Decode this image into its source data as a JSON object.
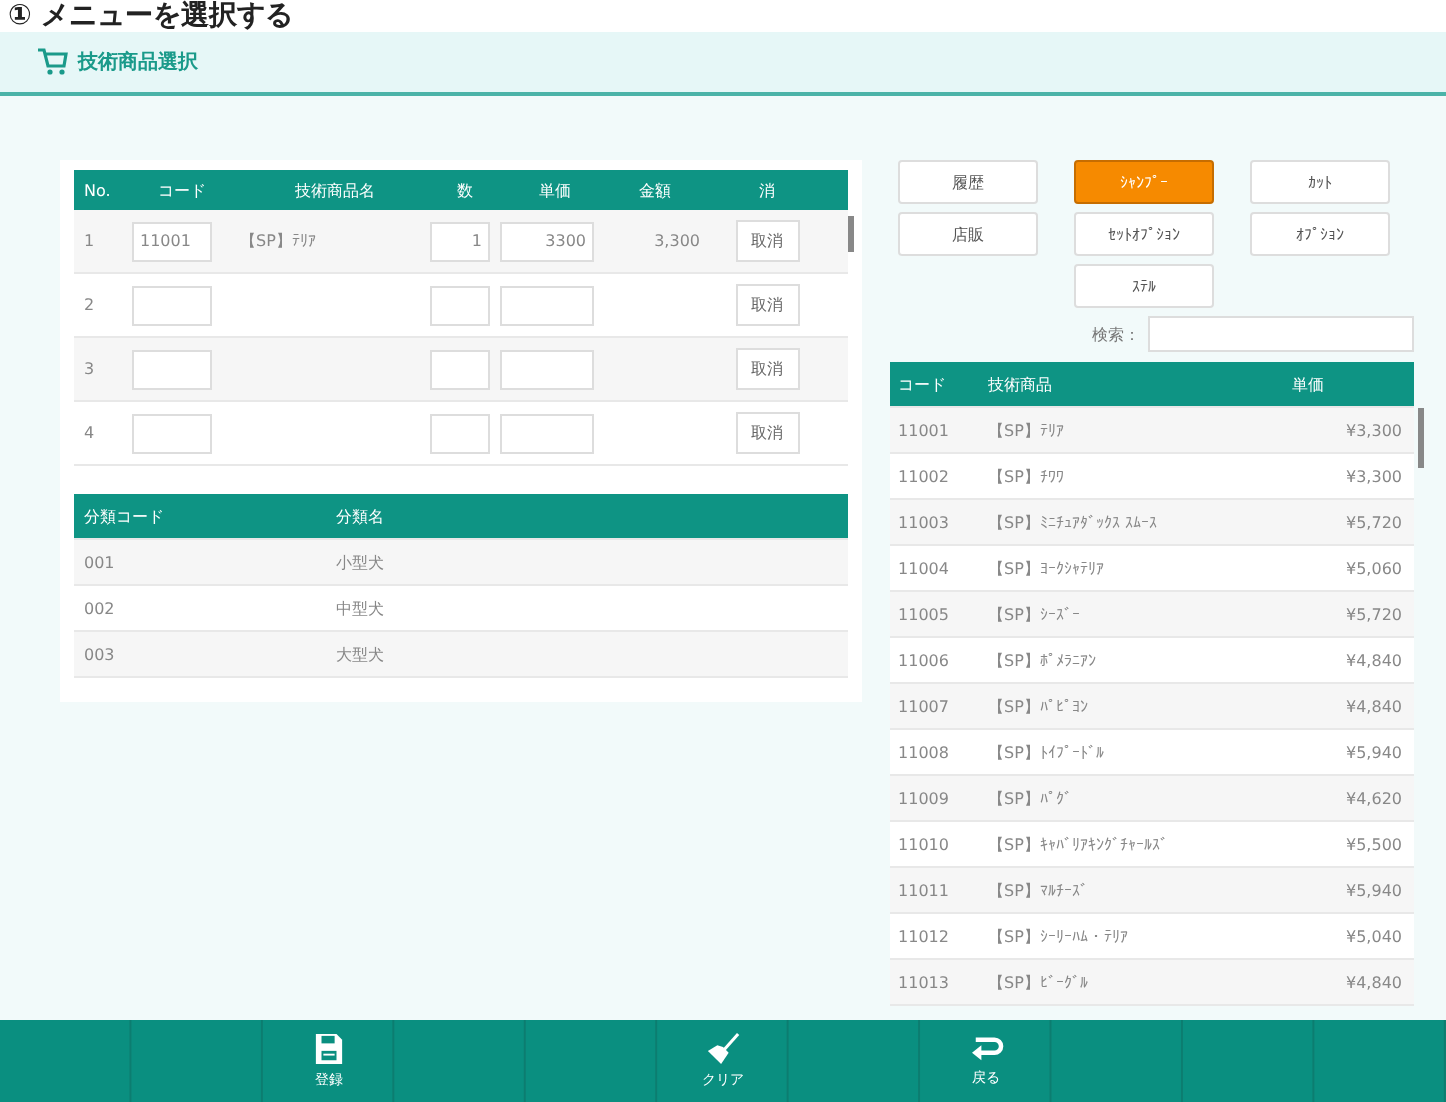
{
  "page_heading": "① メニューを選択する",
  "header": {
    "title": "技術商品選択"
  },
  "order_table": {
    "columns": [
      "No.",
      "コード",
      "技術商品名",
      "数",
      "単価",
      "金額",
      "消"
    ],
    "rows": [
      {
        "no": "1",
        "code": "11001",
        "name": "【SP】ﾃﾘｱ",
        "qty": "1",
        "price": "3300",
        "amount": "3,300",
        "cancel": "取消"
      },
      {
        "no": "2",
        "cancel": "取消"
      },
      {
        "no": "3",
        "cancel": "取消"
      },
      {
        "no": "4",
        "cancel": "取消"
      }
    ]
  },
  "class_table": {
    "columns": [
      "分類コード",
      "分類名"
    ],
    "rows": [
      {
        "code": "001",
        "name": "小型犬"
      },
      {
        "code": "002",
        "name": "中型犬"
      },
      {
        "code": "003",
        "name": "大型犬"
      }
    ]
  },
  "categories": [
    {
      "label": "履歴",
      "selected": false
    },
    {
      "label": "ｼｬﾝﾌﾟｰ",
      "selected": true
    },
    {
      "label": "ｶｯﾄ",
      "selected": false
    },
    {
      "label": "店販",
      "selected": false
    },
    {
      "label": "ｾｯﾄｵﾌﾟｼｮﾝ",
      "selected": false
    },
    {
      "label": "ｵﾌﾟｼｮﾝ",
      "selected": false
    },
    {
      "label": "ｽﾃﾙ",
      "selected": false
    }
  ],
  "search": {
    "label": "検索："
  },
  "product_table": {
    "columns": [
      "コード",
      "技術商品",
      "単価"
    ],
    "rows": [
      {
        "code": "11001",
        "name": "【SP】ﾃﾘｱ",
        "price": "¥3,300"
      },
      {
        "code": "11002",
        "name": "【SP】ﾁﾜﾜ",
        "price": "¥3,300"
      },
      {
        "code": "11003",
        "name": "【SP】ﾐﾆﾁｭｱﾀﾞｯｸｽ ｽﾑｰｽ",
        "price": "¥5,720"
      },
      {
        "code": "11004",
        "name": "【SP】ﾖｰｸｼｬﾃﾘｱ",
        "price": "¥5,060"
      },
      {
        "code": "11005",
        "name": "【SP】ｼｰｽﾞｰ",
        "price": "¥5,720"
      },
      {
        "code": "11006",
        "name": "【SP】ﾎﾟﾒﾗﾆｱﾝ",
        "price": "¥4,840"
      },
      {
        "code": "11007",
        "name": "【SP】ﾊﾟﾋﾟﾖﾝ",
        "price": "¥4,840"
      },
      {
        "code": "11008",
        "name": "【SP】ﾄｲﾌﾟｰﾄﾞﾙ",
        "price": "¥5,940"
      },
      {
        "code": "11009",
        "name": "【SP】ﾊﾟｸﾞ",
        "price": "¥4,620"
      },
      {
        "code": "11010",
        "name": "【SP】ｷｬﾊﾞﾘｱｷﾝｸﾞﾁｬｰﾙｽﾞ",
        "price": "¥5,500"
      },
      {
        "code": "11011",
        "name": "【SP】ﾏﾙﾁｰｽﾞ",
        "price": "¥5,940"
      },
      {
        "code": "11012",
        "name": "【SP】ｼｰﾘｰﾊﾑ・ﾃﾘｱ",
        "price": "¥5,040"
      },
      {
        "code": "11013",
        "name": "【SP】ﾋﾞｰｸﾞﾙ",
        "price": "¥4,840"
      }
    ]
  },
  "footer": [
    {
      "kind": "blank"
    },
    {
      "kind": "blank"
    },
    {
      "kind": "save",
      "label": "登録"
    },
    {
      "kind": "blank"
    },
    {
      "kind": "blank"
    },
    {
      "kind": "clear",
      "label": "クリア"
    },
    {
      "kind": "blank"
    },
    {
      "kind": "back",
      "label": "戻る"
    },
    {
      "kind": "blank"
    },
    {
      "kind": "blank"
    },
    {
      "kind": "blank"
    }
  ]
}
